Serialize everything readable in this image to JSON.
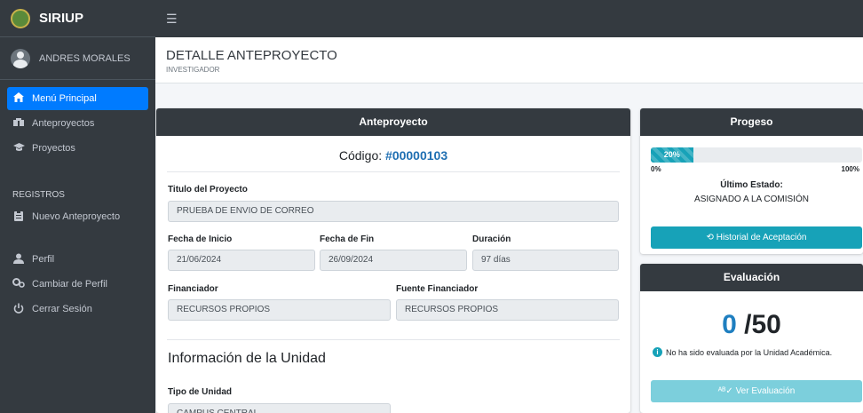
{
  "brand": {
    "name": "SIRIUP"
  },
  "user": {
    "name": "ANDRES MORALES"
  },
  "sidebar": {
    "items": [
      {
        "label": "Menú Principal",
        "icon": "home-icon"
      },
      {
        "label": "Anteproyectos",
        "icon": "boxes-icon"
      },
      {
        "label": "Proyectos",
        "icon": "graduation-cap-icon"
      }
    ],
    "section_label": "REGISTROS",
    "registro_items": [
      {
        "label": "Nuevo Anteproyecto",
        "icon": "clipboard-icon"
      }
    ],
    "account_items": [
      {
        "label": "Perfil",
        "icon": "user-icon"
      },
      {
        "label": "Cambiar de Perfil",
        "icon": "gears-icon"
      },
      {
        "label": "Cerrar Sesión",
        "icon": "power-icon"
      }
    ]
  },
  "header": {
    "title": "DETALLE ANTEPROYECTO",
    "subtitle": "INVESTIGADOR"
  },
  "main": {
    "card_title": "Anteproyecto",
    "code_label": "Código:",
    "code_value": "#00000103",
    "titulo_label": "Titulo del Proyecto",
    "titulo_value": "PRUEBA DE ENVIO DE CORREO",
    "inicio_label": "Fecha de Inicio",
    "inicio_value": "21/06/2024",
    "fin_label": "Fecha de Fin",
    "fin_value": "26/09/2024",
    "duracion_label": "Duración",
    "duracion_value": "97 días",
    "financiador_label": "Financiador",
    "financiador_value": "RECURSOS PROPIOS",
    "fuente_label": "Fuente Financiador",
    "fuente_value": "RECURSOS PROPIOS",
    "unidad_section": "Información de la Unidad",
    "tipo_label": "Tipo de Unidad",
    "tipo_value": "CAMPUS CENTRAL"
  },
  "progress": {
    "card_title": "Progeso",
    "percent_text": "20%",
    "percent": 0.2,
    "min": "0%",
    "max": "100%",
    "state_label": "Último Estado:",
    "state_value": "ASIGNADO A LA COMISIÓN",
    "history_button": "Historial de Aceptación"
  },
  "evaluation": {
    "card_title": "Evaluación",
    "score": "0",
    "total": " /50",
    "note": "No ha sido evaluada por la Unidad Académica.",
    "view_button": "Ver Evaluación"
  },
  "colors": {
    "sidebar": "#343a40",
    "primary": "#007bff",
    "info": "#17a2b8",
    "score": "#1f7fc0"
  }
}
